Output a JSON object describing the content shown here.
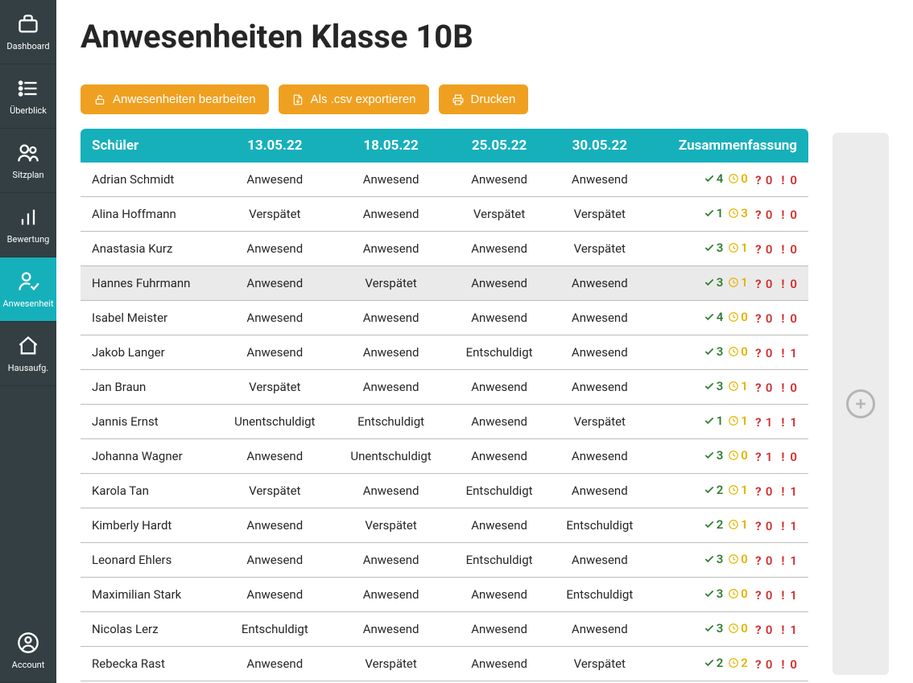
{
  "page": {
    "title": "Anwesenheiten Klasse 10B"
  },
  "nav": [
    {
      "id": "dashboard",
      "label": "Dashboard",
      "icon": "briefcase-icon",
      "active": false
    },
    {
      "id": "overview",
      "label": "Überblick",
      "icon": "list-icon",
      "active": false
    },
    {
      "id": "seating",
      "label": "Sitzplan",
      "icon": "people-icon",
      "active": false
    },
    {
      "id": "grading",
      "label": "Bewertung",
      "icon": "bars-icon",
      "active": false
    },
    {
      "id": "attendance",
      "label": "Anwesenheit",
      "icon": "person-check-icon",
      "active": true
    },
    {
      "id": "homework",
      "label": "Hausaufg.",
      "icon": "house-icon",
      "active": false
    }
  ],
  "account": {
    "label": "Account",
    "icon": "account-icon"
  },
  "toolbar": {
    "edit": {
      "label": "Anwesenheiten bearbeiten"
    },
    "export": {
      "label": "Als .csv exportieren"
    },
    "print": {
      "label": "Drucken"
    }
  },
  "table": {
    "headers": {
      "student": "Schüler",
      "summary": "Zusammenfassung"
    },
    "dates": [
      "13.05.22",
      "18.05.22",
      "25.05.22",
      "30.05.22"
    ],
    "rows": [
      {
        "name": "Adrian Schmidt",
        "cells": [
          "Anwesend",
          "Anwesend",
          "Anwesend",
          "Anwesend"
        ],
        "summary": {
          "present": 4,
          "late": 0,
          "unexcused": 0,
          "excused": 0
        },
        "highlight": false
      },
      {
        "name": "Alina Hoffmann",
        "cells": [
          "Verspätet",
          "Anwesend",
          "Verspätet",
          "Verspätet"
        ],
        "summary": {
          "present": 1,
          "late": 3,
          "unexcused": 0,
          "excused": 0
        },
        "highlight": false
      },
      {
        "name": "Anastasia Kurz",
        "cells": [
          "Anwesend",
          "Anwesend",
          "Anwesend",
          "Verspätet"
        ],
        "summary": {
          "present": 3,
          "late": 1,
          "unexcused": 0,
          "excused": 0
        },
        "highlight": false
      },
      {
        "name": "Hannes Fuhrmann",
        "cells": [
          "Anwesend",
          "Verspätet",
          "Anwesend",
          "Anwesend"
        ],
        "summary": {
          "present": 3,
          "late": 1,
          "unexcused": 0,
          "excused": 0
        },
        "highlight": true
      },
      {
        "name": "Isabel Meister",
        "cells": [
          "Anwesend",
          "Anwesend",
          "Anwesend",
          "Anwesend"
        ],
        "summary": {
          "present": 4,
          "late": 0,
          "unexcused": 0,
          "excused": 0
        },
        "highlight": false
      },
      {
        "name": "Jakob Langer",
        "cells": [
          "Anwesend",
          "Anwesend",
          "Entschuldigt",
          "Anwesend"
        ],
        "summary": {
          "present": 3,
          "late": 0,
          "unexcused": 0,
          "excused": 1
        },
        "highlight": false
      },
      {
        "name": "Jan Braun",
        "cells": [
          "Verspätet",
          "Anwesend",
          "Anwesend",
          "Anwesend"
        ],
        "summary": {
          "present": 3,
          "late": 1,
          "unexcused": 0,
          "excused": 0
        },
        "highlight": false
      },
      {
        "name": "Jannis Ernst",
        "cells": [
          "Unentschuldigt",
          "Entschuldigt",
          "Anwesend",
          "Verspätet"
        ],
        "summary": {
          "present": 1,
          "late": 1,
          "unexcused": 1,
          "excused": 1
        },
        "highlight": false
      },
      {
        "name": "Johanna Wagner",
        "cells": [
          "Anwesend",
          "Unentschuldigt",
          "Anwesend",
          "Anwesend"
        ],
        "summary": {
          "present": 3,
          "late": 0,
          "unexcused": 1,
          "excused": 0
        },
        "highlight": false
      },
      {
        "name": "Karola Tan",
        "cells": [
          "Verspätet",
          "Anwesend",
          "Entschuldigt",
          "Anwesend"
        ],
        "summary": {
          "present": 2,
          "late": 1,
          "unexcused": 0,
          "excused": 1
        },
        "highlight": false
      },
      {
        "name": "Kimberly Hardt",
        "cells": [
          "Anwesend",
          "Verspätet",
          "Anwesend",
          "Entschuldigt"
        ],
        "summary": {
          "present": 2,
          "late": 1,
          "unexcused": 0,
          "excused": 1
        },
        "highlight": false
      },
      {
        "name": "Leonard Ehlers",
        "cells": [
          "Anwesend",
          "Anwesend",
          "Entschuldigt",
          "Anwesend"
        ],
        "summary": {
          "present": 3,
          "late": 0,
          "unexcused": 0,
          "excused": 1
        },
        "highlight": false
      },
      {
        "name": "Maximilian Stark",
        "cells": [
          "Anwesend",
          "Anwesend",
          "Anwesend",
          "Entschuldigt"
        ],
        "summary": {
          "present": 3,
          "late": 0,
          "unexcused": 0,
          "excused": 1
        },
        "highlight": false
      },
      {
        "name": "Nicolas Lerz",
        "cells": [
          "Entschuldigt",
          "Anwesend",
          "Anwesend",
          "Anwesend"
        ],
        "summary": {
          "present": 3,
          "late": 0,
          "unexcused": 0,
          "excused": 1
        },
        "highlight": false
      },
      {
        "name": "Rebecka Rast",
        "cells": [
          "Anwesend",
          "Verspätet",
          "Anwesend",
          "Verspätet"
        ],
        "summary": {
          "present": 2,
          "late": 2,
          "unexcused": 0,
          "excused": 0
        },
        "highlight": false
      }
    ]
  }
}
